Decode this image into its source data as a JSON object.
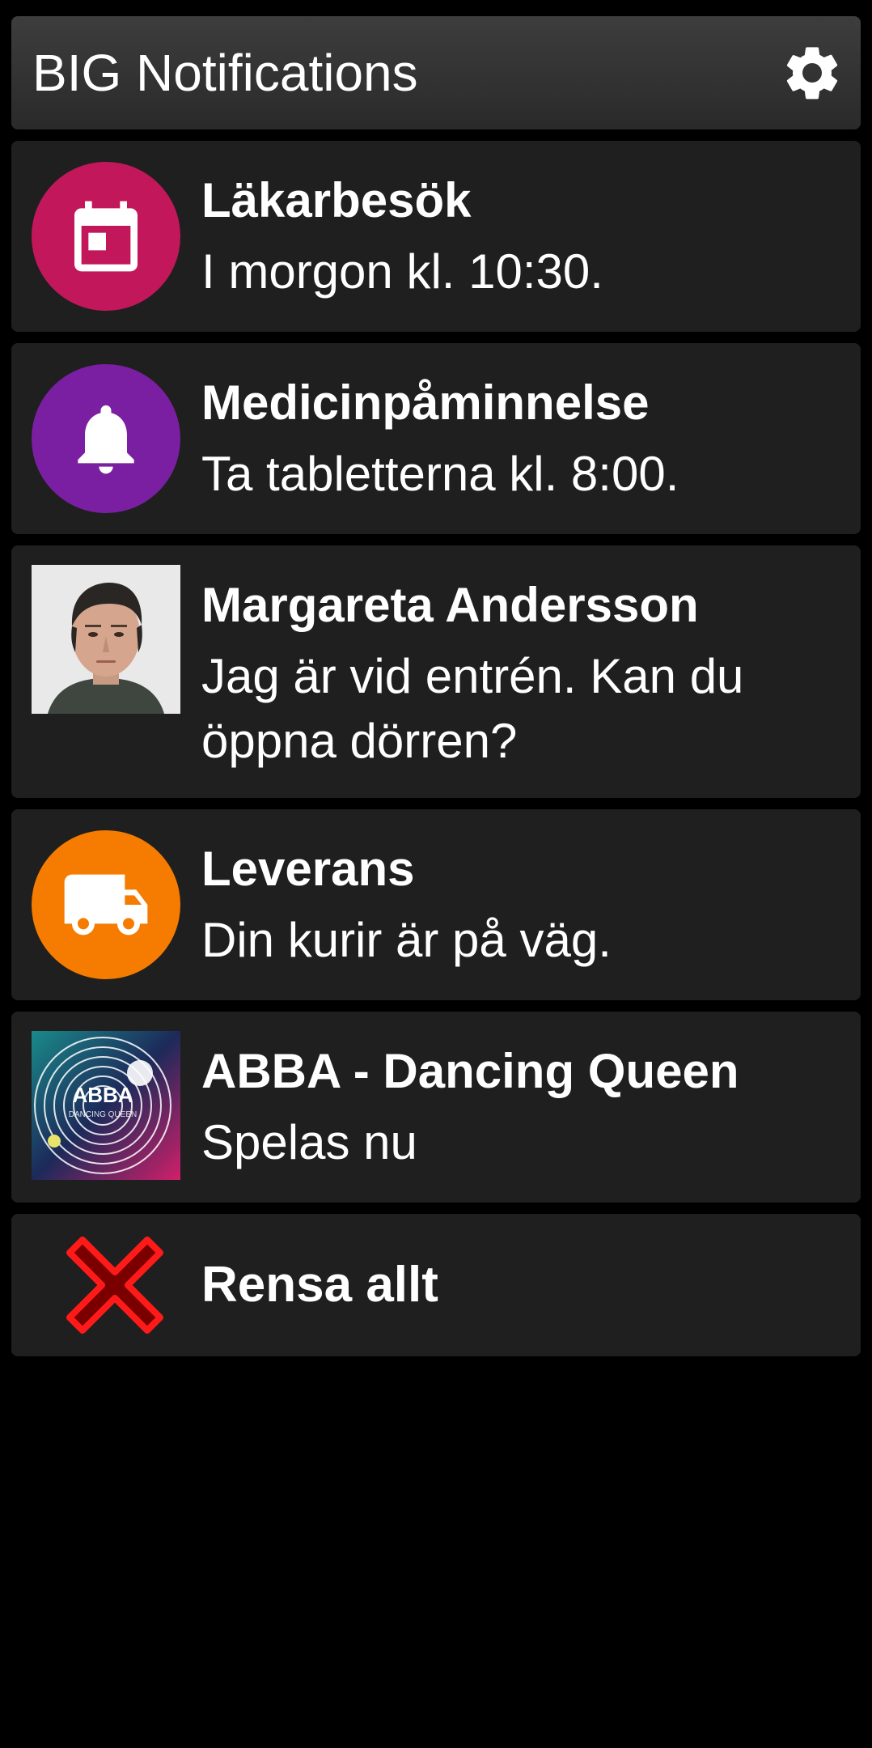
{
  "header": {
    "title": "BIG Notifications",
    "settings_icon": "gear-icon"
  },
  "notifications": [
    {
      "icon": "calendar-icon",
      "icon_color": "#c2185b",
      "title": "Läkarbesök",
      "body": "I morgon kl. 10:30."
    },
    {
      "icon": "bell-icon",
      "icon_color": "#7b1fa2",
      "title": "Medicinpåminnelse",
      "body": "Ta tabletterna kl. 8:00."
    },
    {
      "icon": "contact-photo",
      "title": "Margareta Andersson",
      "body": "Jag är vid entrén. Kan du öppna dörren?"
    },
    {
      "icon": "truck-icon",
      "icon_color": "#f57c00",
      "title": "Leverans",
      "body": "Din kurir är på väg."
    },
    {
      "icon": "album-art",
      "title": "ABBA - Dancing Queen",
      "body": "Spelas nu",
      "album_text": "ABBA",
      "album_subtext": "DANCING QUEEN"
    }
  ],
  "clear_all": {
    "label": "Rensa allt",
    "icon": "close-icon",
    "icon_color": "#e00000"
  }
}
